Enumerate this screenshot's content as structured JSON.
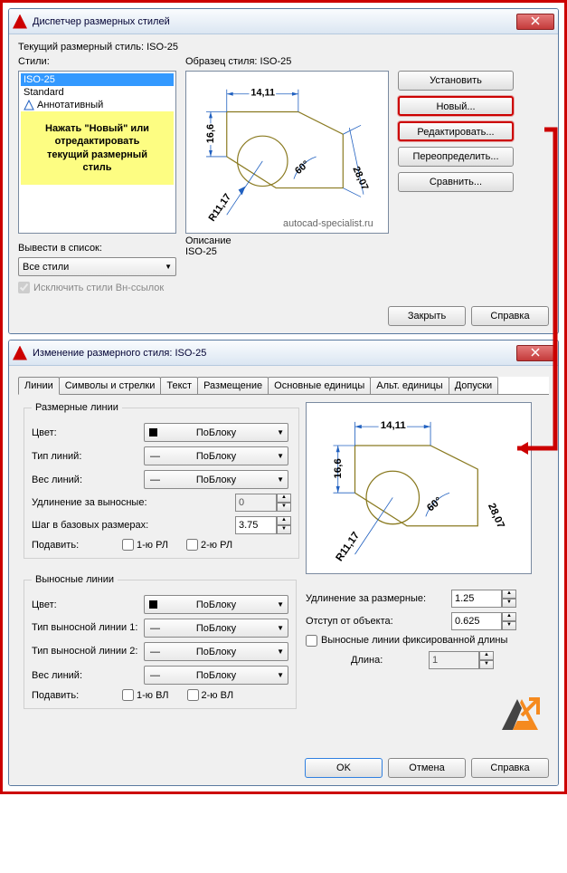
{
  "win1": {
    "title": "Диспетчер размерных стилей",
    "current": "Текущий размерный стиль: ISO-25",
    "styles_label": "Стили:",
    "styles": {
      "i1": "ISO-25",
      "i2": "Standard",
      "i3": "Аннотативный"
    },
    "note": {
      "l1": "Нажать \"Новый\" или",
      "l2": "отредактировать",
      "l3": "текущий размерный",
      "l4": "стиль"
    },
    "sample_label": "Образец стиля: ISO-25",
    "watermark": "autocad-specialist.ru",
    "desc_label": "Описание",
    "desc_val": "ISO-25",
    "buttons": {
      "set": "Установить",
      "new": "Новый...",
      "edit": "Редактировать...",
      "over": "Переопределить...",
      "cmp": "Сравнить..."
    },
    "list_label": "Вывести в список:",
    "list_val": "Все стили",
    "excl": "Исключить стили Вн-ссылок",
    "close": "Закрыть",
    "help": "Справка"
  },
  "win2": {
    "title": "Изменение размерного стиля: ISO-25",
    "tabs": {
      "t1": "Линии",
      "t2": "Символы и стрелки",
      "t3": "Текст",
      "t4": "Размещение",
      "t5": "Основные единицы",
      "t6": "Альт. единицы",
      "t7": "Допуски"
    },
    "dim_lines": {
      "legend": "Размерные линии",
      "color": "Цвет:",
      "ltype": "Тип линий:",
      "lweight": "Вес линий:",
      "byblock": "ПоБлоку",
      "ext": "Удлинение за выносные:",
      "ext_v": "0",
      "base": "Шаг в базовых размерах:",
      "base_v": "3.75",
      "supp": "Подавить:",
      "s1": "1-ю РЛ",
      "s2": "2-ю РЛ"
    },
    "ext_lines": {
      "legend": "Выносные линии",
      "color": "Цвет:",
      "lt1": "Тип выносной линии 1:",
      "lt2": "Тип выносной линии 2:",
      "lweight": "Вес линий:",
      "byblock": "ПоБлоку",
      "supp": "Подавить:",
      "s1": "1-ю ВЛ",
      "s2": "2-ю ВЛ",
      "ext_dim": "Удлинение за размерные:",
      "ext_dim_v": "1.25",
      "offset": "Отступ от объекта:",
      "offset_v": "0.625",
      "fixed": "Выносные линии фиксированной длины",
      "len": "Длина:",
      "len_v": "1"
    },
    "ok": "OK",
    "cancel": "Отмена",
    "help": "Справка"
  },
  "preview": {
    "d1": "14,11",
    "d2": "16,6",
    "d3": "28,07",
    "d4": "R11,17",
    "a": "60°",
    "a2": "60°"
  }
}
